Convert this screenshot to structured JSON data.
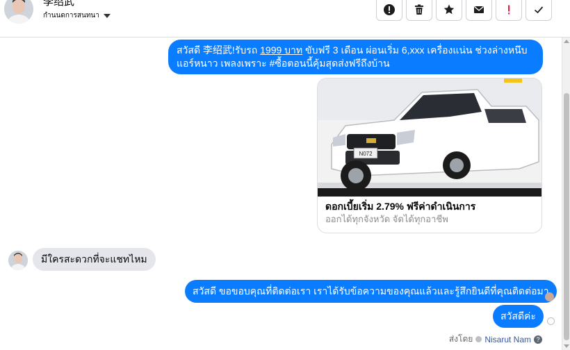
{
  "header": {
    "contact_name": "李绍武",
    "status": "กำนนดการสนทนา"
  },
  "toolbar": [
    "spam-icon",
    "trash-icon",
    "star-icon",
    "mail-icon",
    "important-icon",
    "check-icon"
  ],
  "messages": {
    "intro_part1": "สวัสดี 李绍武!รับรถ ",
    "intro_price": "1999 บาท",
    "intro_part2": " ขับฟรี 3 เดือน ผ่อนเริ่ม 6,xxx   เครื่องแน่น ช่วงล่างหนึบ แอร์หนาว เพลงเพราะ #ซื้อตอนนี้คุ้มสุดส่งฟรีถึงบ้าน",
    "card_title": "ดอกเบี้ยเริ่ม 2.79% ฟรีค่าดำเนินการ",
    "card_subtitle": "ออกได้ทุกจังหวัด จัดได้ทุกอาชีพ",
    "card_plate": "N072",
    "incoming": "มีใครสะดวกที่จะแชทไหม",
    "reply1": "สวัสดี ขอขอบคุณที่ติดต่อเรา เราได้รับข้อความของคุณแล้วและรู้สึกยินดีที่คุณติดต่อมา",
    "reply2": "สวัสดีค่ะ"
  },
  "footer": {
    "sent_by_label": "ส่งโดย",
    "sender": "Nisarut Nam",
    "help": "?"
  },
  "colors": {
    "outgoing_bubble": "#0a7cff",
    "incoming_bubble": "#e4e6eb",
    "important": "#e41e3f"
  }
}
